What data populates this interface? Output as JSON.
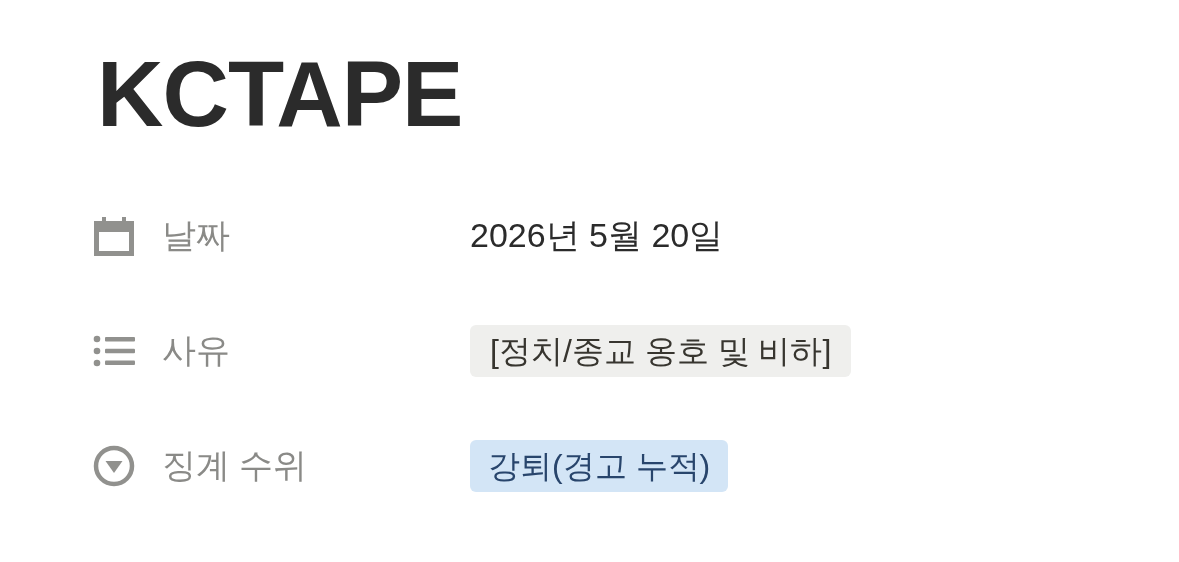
{
  "title": "KCTAPE",
  "properties": [
    {
      "kind": "date",
      "label": "날짜",
      "value": "2026년 5월 20일"
    },
    {
      "kind": "multi_select",
      "label": "사유",
      "tags": [
        {
          "text": "[정치/종교 옹호 및 비하]",
          "color": "#efefed"
        }
      ]
    },
    {
      "kind": "select",
      "label": "징계 수위",
      "tags": [
        {
          "text": "강퇴(경고 누적)",
          "color": "#d3e5f6"
        }
      ]
    }
  ]
}
